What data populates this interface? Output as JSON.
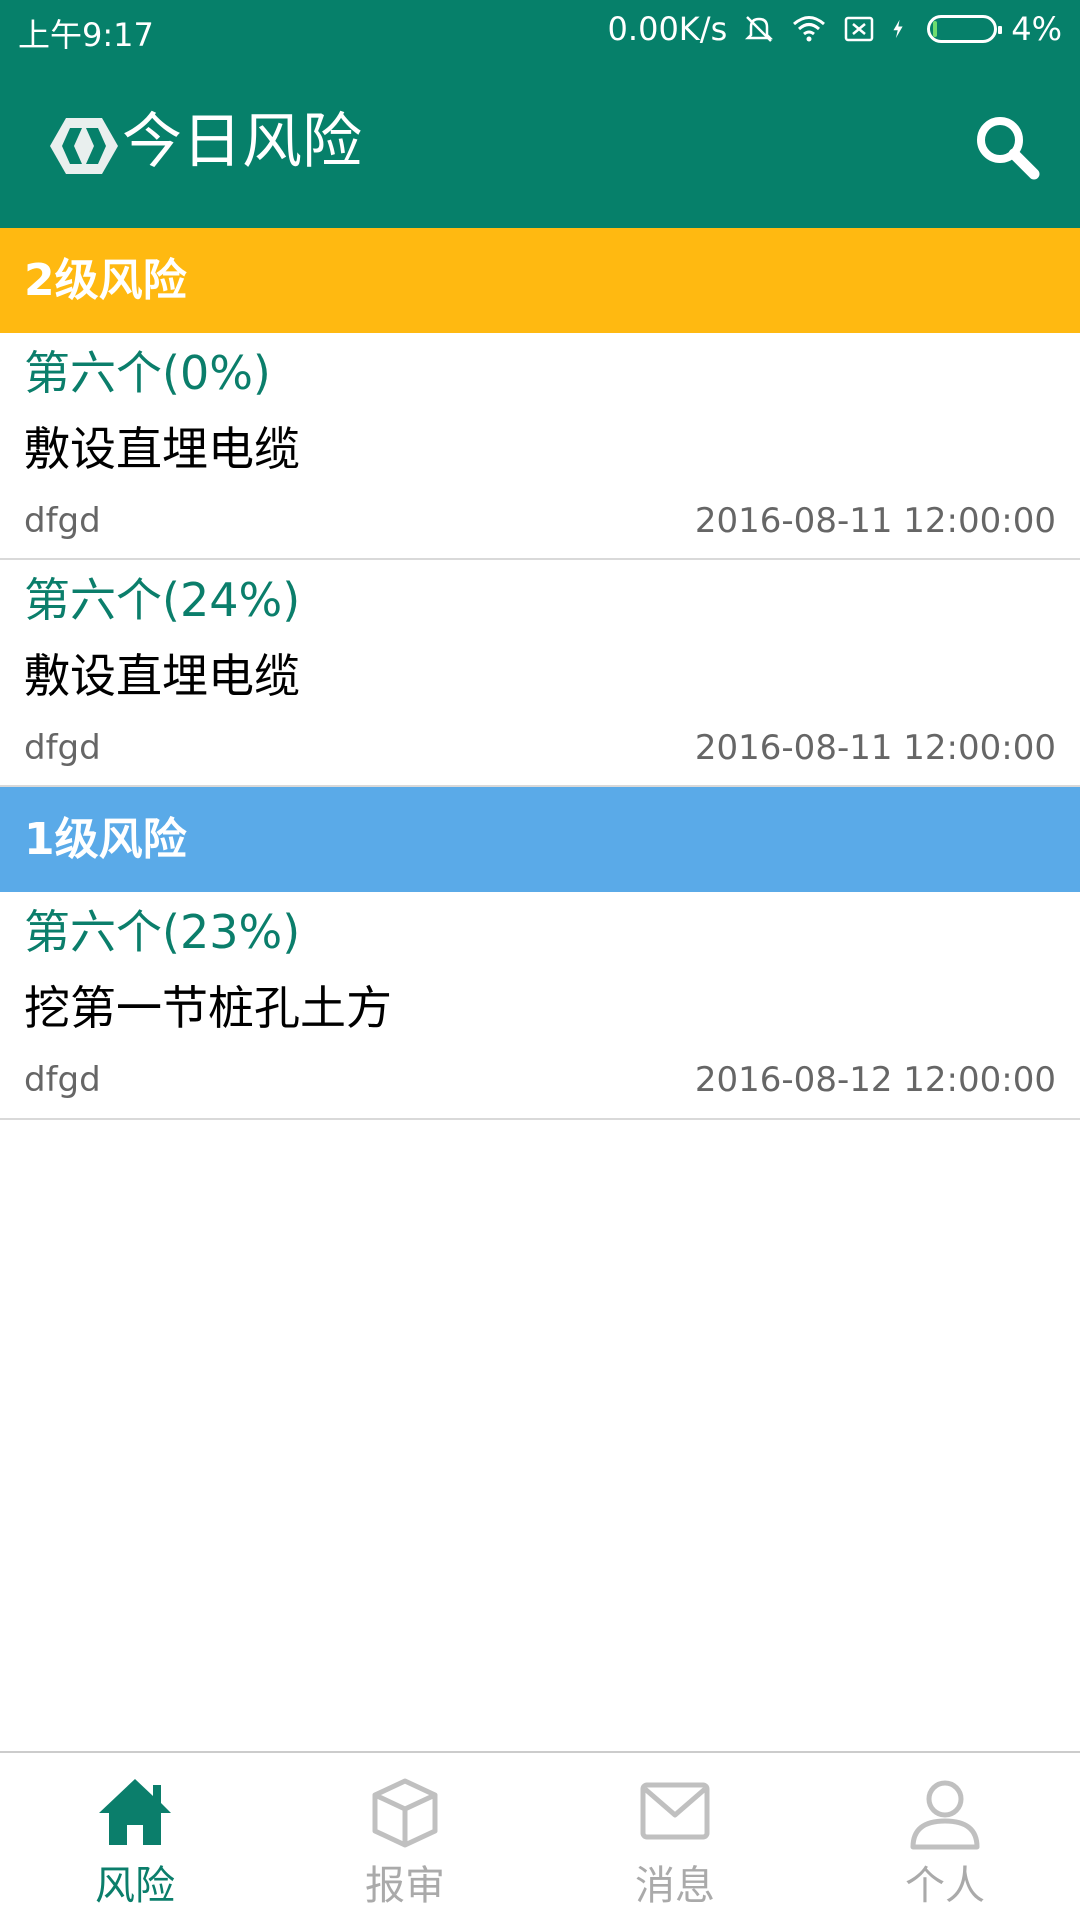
{
  "status_bar": {
    "time": "上午9:17",
    "net_speed": "0.00K/s",
    "battery": "4%",
    "battery_level": 0.04,
    "icons": [
      "mute-icon",
      "wifi-icon",
      "sim-icon",
      "charging-icon",
      "battery-icon"
    ]
  },
  "app_bar": {
    "title": "今日风险",
    "logo_icon": "app-logo-icon",
    "search_icon": "search-icon"
  },
  "sections": [
    {
      "header": "2级风险",
      "color": "#ffb911",
      "items": [
        {
          "title": "第六个(0%)",
          "name": "敷设直埋电缆",
          "user": "dfgd",
          "date": "2016-08-11 12:00:00"
        },
        {
          "title": "第六个(24%)",
          "name": "敷设直埋电缆",
          "user": "dfgd",
          "date": "2016-08-11 12:00:00"
        }
      ]
    },
    {
      "header": "1级风险",
      "color": "#5aaae8",
      "items": [
        {
          "title": "第六个(23%)",
          "name": "挖第一节桩孔土方",
          "user": "dfgd",
          "date": "2016-08-12 12:00:00"
        }
      ]
    }
  ],
  "bottom_nav": {
    "items": [
      {
        "label": "风险",
        "icon": "home-icon",
        "active": true
      },
      {
        "label": "报审",
        "icon": "cube-icon",
        "active": false
      },
      {
        "label": "消息",
        "icon": "mail-icon",
        "active": false
      },
      {
        "label": "个人",
        "icon": "person-icon",
        "active": false
      }
    ],
    "active_color": "#0b7e6b",
    "inactive_color": "#aaaaaa"
  }
}
